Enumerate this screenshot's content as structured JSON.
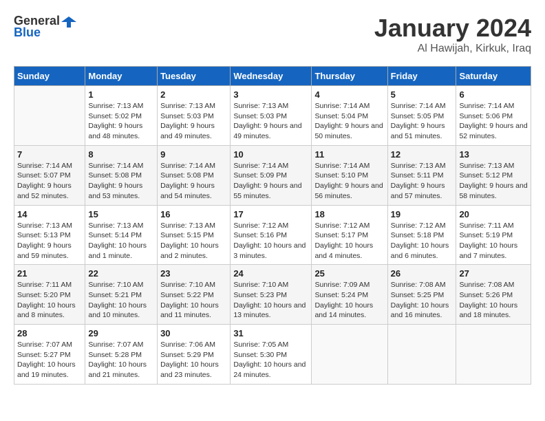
{
  "header": {
    "logo": {
      "text_general": "General",
      "text_blue": "Blue"
    },
    "title": "January 2024",
    "location": "Al Hawijah, Kirkuk, Iraq"
  },
  "days_of_week": [
    "Sunday",
    "Monday",
    "Tuesday",
    "Wednesday",
    "Thursday",
    "Friday",
    "Saturday"
  ],
  "weeks": [
    [
      {
        "day": "",
        "sunrise": "",
        "sunset": "",
        "daylight": ""
      },
      {
        "day": "1",
        "sunrise": "Sunrise: 7:13 AM",
        "sunset": "Sunset: 5:02 PM",
        "daylight": "Daylight: 9 hours and 48 minutes."
      },
      {
        "day": "2",
        "sunrise": "Sunrise: 7:13 AM",
        "sunset": "Sunset: 5:03 PM",
        "daylight": "Daylight: 9 hours and 49 minutes."
      },
      {
        "day": "3",
        "sunrise": "Sunrise: 7:13 AM",
        "sunset": "Sunset: 5:03 PM",
        "daylight": "Daylight: 9 hours and 49 minutes."
      },
      {
        "day": "4",
        "sunrise": "Sunrise: 7:14 AM",
        "sunset": "Sunset: 5:04 PM",
        "daylight": "Daylight: 9 hours and 50 minutes."
      },
      {
        "day": "5",
        "sunrise": "Sunrise: 7:14 AM",
        "sunset": "Sunset: 5:05 PM",
        "daylight": "Daylight: 9 hours and 51 minutes."
      },
      {
        "day": "6",
        "sunrise": "Sunrise: 7:14 AM",
        "sunset": "Sunset: 5:06 PM",
        "daylight": "Daylight: 9 hours and 52 minutes."
      }
    ],
    [
      {
        "day": "7",
        "sunrise": "Sunrise: 7:14 AM",
        "sunset": "Sunset: 5:07 PM",
        "daylight": "Daylight: 9 hours and 52 minutes."
      },
      {
        "day": "8",
        "sunrise": "Sunrise: 7:14 AM",
        "sunset": "Sunset: 5:08 PM",
        "daylight": "Daylight: 9 hours and 53 minutes."
      },
      {
        "day": "9",
        "sunrise": "Sunrise: 7:14 AM",
        "sunset": "Sunset: 5:08 PM",
        "daylight": "Daylight: 9 hours and 54 minutes."
      },
      {
        "day": "10",
        "sunrise": "Sunrise: 7:14 AM",
        "sunset": "Sunset: 5:09 PM",
        "daylight": "Daylight: 9 hours and 55 minutes."
      },
      {
        "day": "11",
        "sunrise": "Sunrise: 7:14 AM",
        "sunset": "Sunset: 5:10 PM",
        "daylight": "Daylight: 9 hours and 56 minutes."
      },
      {
        "day": "12",
        "sunrise": "Sunrise: 7:13 AM",
        "sunset": "Sunset: 5:11 PM",
        "daylight": "Daylight: 9 hours and 57 minutes."
      },
      {
        "day": "13",
        "sunrise": "Sunrise: 7:13 AM",
        "sunset": "Sunset: 5:12 PM",
        "daylight": "Daylight: 9 hours and 58 minutes."
      }
    ],
    [
      {
        "day": "14",
        "sunrise": "Sunrise: 7:13 AM",
        "sunset": "Sunset: 5:13 PM",
        "daylight": "Daylight: 9 hours and 59 minutes."
      },
      {
        "day": "15",
        "sunrise": "Sunrise: 7:13 AM",
        "sunset": "Sunset: 5:14 PM",
        "daylight": "Daylight: 10 hours and 1 minute."
      },
      {
        "day": "16",
        "sunrise": "Sunrise: 7:13 AM",
        "sunset": "Sunset: 5:15 PM",
        "daylight": "Daylight: 10 hours and 2 minutes."
      },
      {
        "day": "17",
        "sunrise": "Sunrise: 7:12 AM",
        "sunset": "Sunset: 5:16 PM",
        "daylight": "Daylight: 10 hours and 3 minutes."
      },
      {
        "day": "18",
        "sunrise": "Sunrise: 7:12 AM",
        "sunset": "Sunset: 5:17 PM",
        "daylight": "Daylight: 10 hours and 4 minutes."
      },
      {
        "day": "19",
        "sunrise": "Sunrise: 7:12 AM",
        "sunset": "Sunset: 5:18 PM",
        "daylight": "Daylight: 10 hours and 6 minutes."
      },
      {
        "day": "20",
        "sunrise": "Sunrise: 7:11 AM",
        "sunset": "Sunset: 5:19 PM",
        "daylight": "Daylight: 10 hours and 7 minutes."
      }
    ],
    [
      {
        "day": "21",
        "sunrise": "Sunrise: 7:11 AM",
        "sunset": "Sunset: 5:20 PM",
        "daylight": "Daylight: 10 hours and 8 minutes."
      },
      {
        "day": "22",
        "sunrise": "Sunrise: 7:10 AM",
        "sunset": "Sunset: 5:21 PM",
        "daylight": "Daylight: 10 hours and 10 minutes."
      },
      {
        "day": "23",
        "sunrise": "Sunrise: 7:10 AM",
        "sunset": "Sunset: 5:22 PM",
        "daylight": "Daylight: 10 hours and 11 minutes."
      },
      {
        "day": "24",
        "sunrise": "Sunrise: 7:10 AM",
        "sunset": "Sunset: 5:23 PM",
        "daylight": "Daylight: 10 hours and 13 minutes."
      },
      {
        "day": "25",
        "sunrise": "Sunrise: 7:09 AM",
        "sunset": "Sunset: 5:24 PM",
        "daylight": "Daylight: 10 hours and 14 minutes."
      },
      {
        "day": "26",
        "sunrise": "Sunrise: 7:08 AM",
        "sunset": "Sunset: 5:25 PM",
        "daylight": "Daylight: 10 hours and 16 minutes."
      },
      {
        "day": "27",
        "sunrise": "Sunrise: 7:08 AM",
        "sunset": "Sunset: 5:26 PM",
        "daylight": "Daylight: 10 hours and 18 minutes."
      }
    ],
    [
      {
        "day": "28",
        "sunrise": "Sunrise: 7:07 AM",
        "sunset": "Sunset: 5:27 PM",
        "daylight": "Daylight: 10 hours and 19 minutes."
      },
      {
        "day": "29",
        "sunrise": "Sunrise: 7:07 AM",
        "sunset": "Sunset: 5:28 PM",
        "daylight": "Daylight: 10 hours and 21 minutes."
      },
      {
        "day": "30",
        "sunrise": "Sunrise: 7:06 AM",
        "sunset": "Sunset: 5:29 PM",
        "daylight": "Daylight: 10 hours and 23 minutes."
      },
      {
        "day": "31",
        "sunrise": "Sunrise: 7:05 AM",
        "sunset": "Sunset: 5:30 PM",
        "daylight": "Daylight: 10 hours and 24 minutes."
      },
      {
        "day": "",
        "sunrise": "",
        "sunset": "",
        "daylight": ""
      },
      {
        "day": "",
        "sunrise": "",
        "sunset": "",
        "daylight": ""
      },
      {
        "day": "",
        "sunrise": "",
        "sunset": "",
        "daylight": ""
      }
    ]
  ]
}
